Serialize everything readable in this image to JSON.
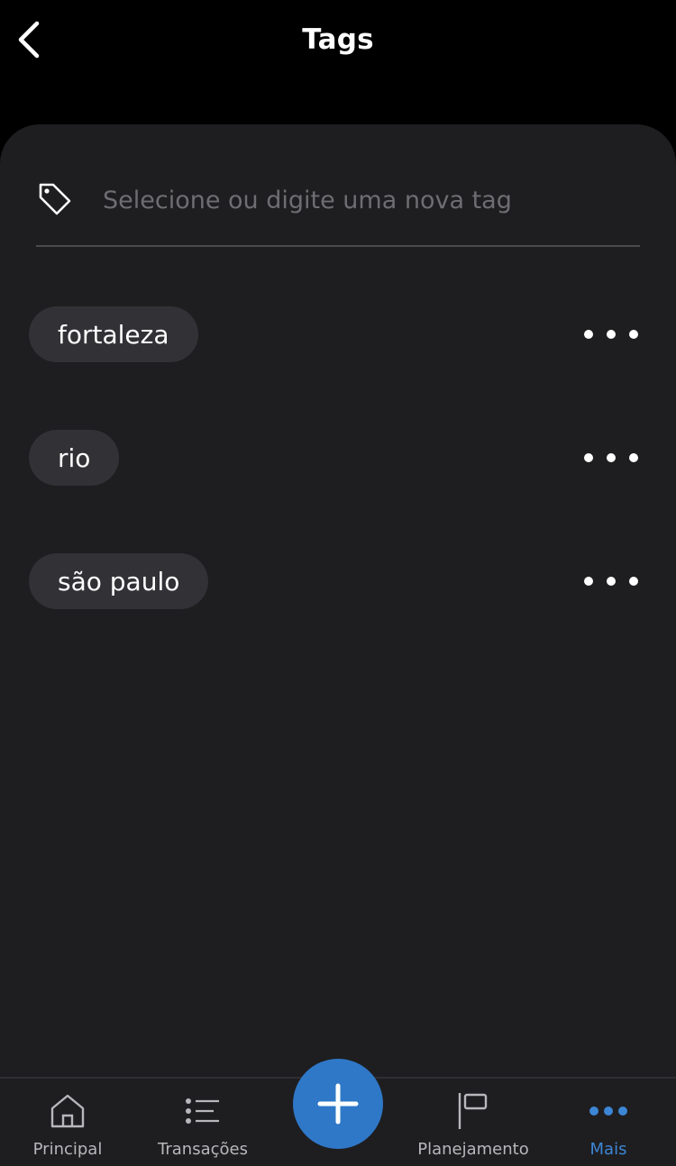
{
  "header": {
    "title": "Tags",
    "back_icon": "chevron-left-icon"
  },
  "tag_input": {
    "icon": "tag-icon",
    "placeholder": "Selecione ou digite uma nova tag",
    "value": ""
  },
  "tags": [
    {
      "label": "fortaleza",
      "menu_icon": "more-horizontal-icon"
    },
    {
      "label": "rio",
      "menu_icon": "more-horizontal-icon"
    },
    {
      "label": "são paulo",
      "menu_icon": "more-horizontal-icon"
    }
  ],
  "bottom_nav": {
    "items": [
      {
        "label": "Principal",
        "icon": "home-icon",
        "active": false
      },
      {
        "label": "Transações",
        "icon": "list-icon",
        "active": false
      },
      {
        "label": "Planejamento",
        "icon": "flag-icon",
        "active": false
      },
      {
        "label": "Mais",
        "icon": "more-horizontal-icon",
        "active": true
      }
    ],
    "fab_icon": "plus-icon"
  },
  "colors": {
    "background": "#000000",
    "card": "#1e1e20",
    "chip": "#323236",
    "accent": "#2f78c8",
    "active_label": "#3d86d6",
    "inactive_label": "#b8b8bc",
    "placeholder": "#6e6e72"
  }
}
